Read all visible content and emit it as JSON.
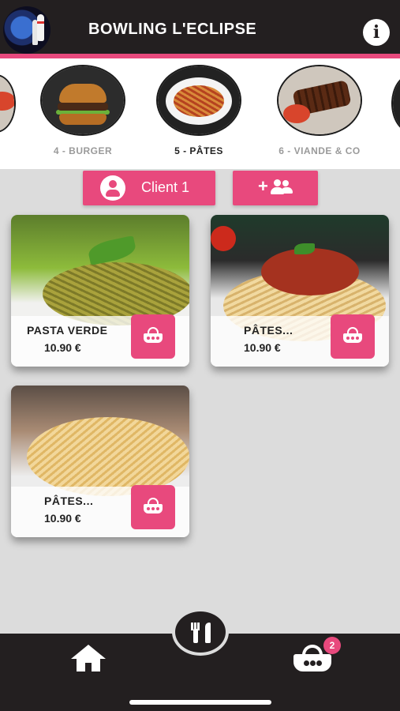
{
  "header": {
    "title": "BOWLING L'ECLIPSE",
    "logo_icon": "bowling-logo",
    "info_icon": "info-icon",
    "info_label": "i",
    "accent_color": "#e8497d",
    "bar_color": "#231f20"
  },
  "categories": [
    {
      "label": "4 - BURGER",
      "icon": "burger",
      "active": false
    },
    {
      "label": "5 - PÂTES",
      "icon": "pasta",
      "active": true
    },
    {
      "label": "6 - VIANDE & CO",
      "icon": "meat",
      "active": false
    }
  ],
  "client": {
    "current_label": "Client 1",
    "add_plus": "+"
  },
  "products": [
    {
      "name": "PASTA VERDE",
      "price": "10.90 €"
    },
    {
      "name": "PÂTES...",
      "price": "10.90 €"
    },
    {
      "name": "PÂTES...",
      "price": "10.90 €"
    }
  ],
  "bottom_nav": {
    "home_icon": "home-icon",
    "menu_icon": "fork-knife-icon",
    "cart_icon": "basket-icon",
    "cart_count": "2"
  }
}
